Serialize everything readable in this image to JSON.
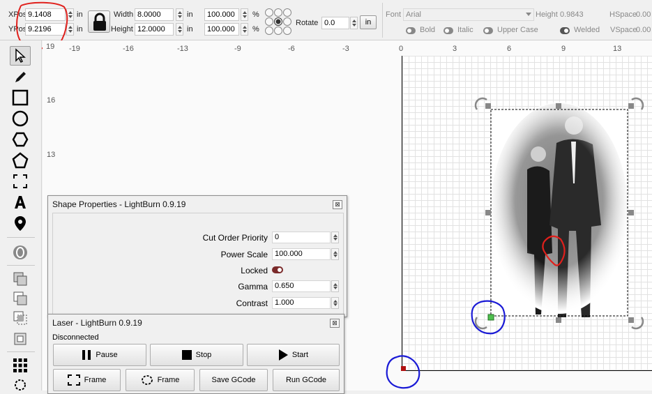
{
  "toolbar": {
    "xpos": {
      "label": "XPos",
      "value": "9.1408",
      "unit": "in"
    },
    "ypos": {
      "label": "YPos",
      "value": "9.2196",
      "unit": "in"
    },
    "width": {
      "label": "Width",
      "value": "8.0000",
      "unit": "in"
    },
    "height": {
      "label": "Height",
      "value": "12.0000",
      "unit": "in"
    },
    "scale_w": {
      "value": "100.000",
      "unit": "%"
    },
    "scale_h": {
      "value": "100.000",
      "unit": "%"
    },
    "rotate": {
      "label": "Rotate",
      "value": "0.0"
    },
    "in_button": "in",
    "font": {
      "label": "Font",
      "value": "Arial"
    },
    "text_height": {
      "label": "Height",
      "value": "0.9843"
    },
    "hspace": {
      "label": "HSpace",
      "value": "0.00"
    },
    "vspace": {
      "label": "VSpace",
      "value": "0.00"
    },
    "bold": "Bold",
    "italic": "Italic",
    "upper_case": "Upper Case",
    "welded": "Welded"
  },
  "ruler": {
    "left_x": [
      "-19",
      "-16",
      "-13",
      "-9",
      "-6",
      "-3"
    ],
    "right_x": [
      "0",
      "3",
      "6",
      "9",
      "13"
    ],
    "y": [
      "19",
      "16",
      "13"
    ]
  },
  "shape_properties": {
    "title": "Shape Properties - LightBurn 0.9.19",
    "close": "⊠",
    "cut_order_priority": {
      "label": "Cut Order Priority",
      "value": "0"
    },
    "power_scale": {
      "label": "Power Scale",
      "value": "100.000"
    },
    "locked": {
      "label": "Locked"
    },
    "gamma": {
      "label": "Gamma",
      "value": "0.650"
    },
    "contrast": {
      "label": "Contrast",
      "value": "1.000"
    }
  },
  "laser": {
    "title": "Laser - LightBurn 0.9.19",
    "close": "⊠",
    "status": "Disconnected",
    "buttons": {
      "pause": "Pause",
      "stop": "Stop",
      "start": "Start",
      "frame1": "Frame",
      "frame2": "Frame",
      "save_gcode": "Save GCode",
      "run_gcode": "Run GCode"
    }
  },
  "colors": {
    "accent_red_annotation": "#e0201c",
    "accent_blue_annotation": "#1a1ad6",
    "origin_marker": "#b01010",
    "selected_handle": "#3fbf3f"
  }
}
